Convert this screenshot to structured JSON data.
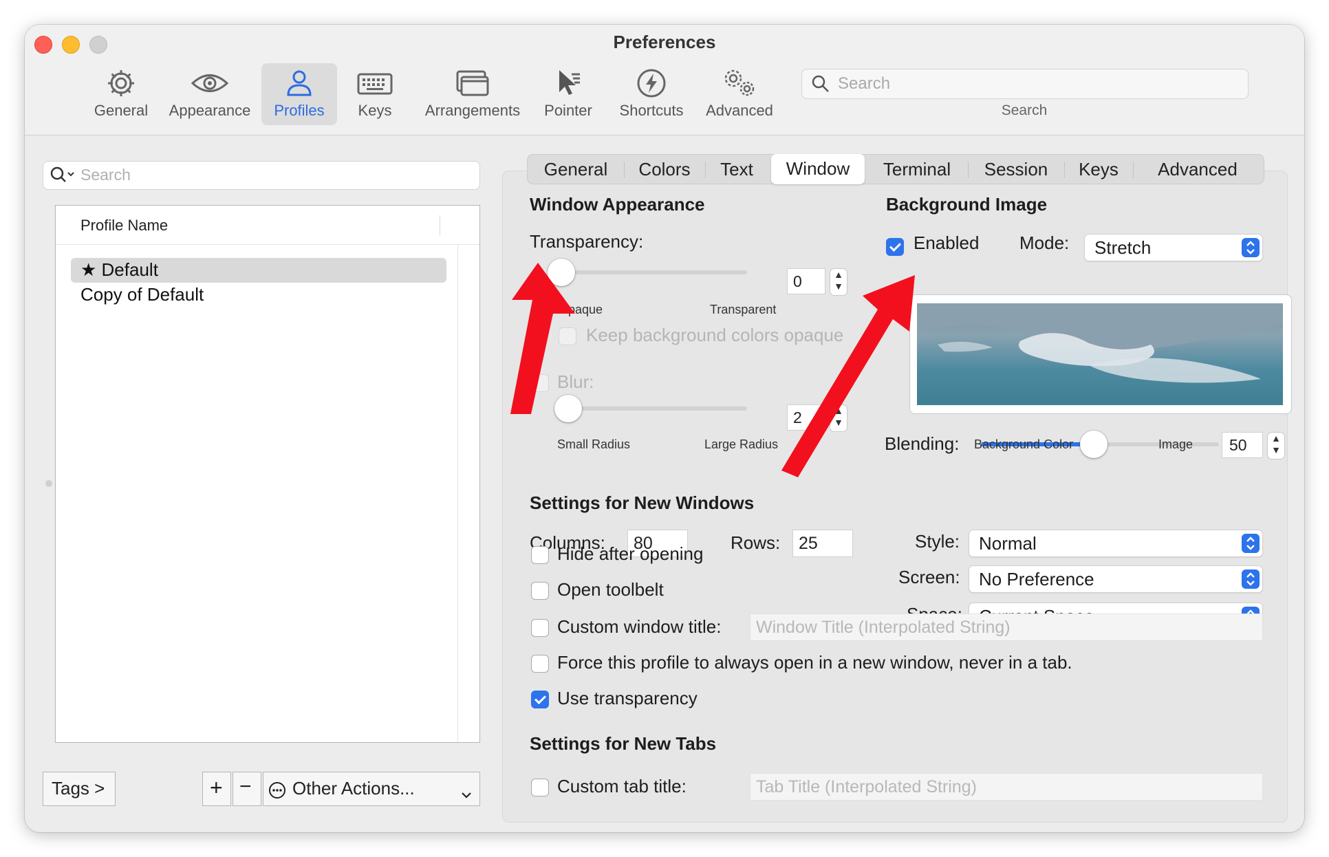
{
  "window": {
    "title": "Preferences"
  },
  "toolbar": {
    "items": [
      {
        "label": "General",
        "icon": "gear-icon"
      },
      {
        "label": "Appearance",
        "icon": "eye-icon"
      },
      {
        "label": "Profiles",
        "icon": "person-icon",
        "selected": true
      },
      {
        "label": "Keys",
        "icon": "keyboard-icon"
      },
      {
        "label": "Arrangements",
        "icon": "windows-icon"
      },
      {
        "label": "Pointer",
        "icon": "pointer-icon"
      },
      {
        "label": "Shortcuts",
        "icon": "lightning-icon"
      },
      {
        "label": "Advanced",
        "icon": "gears-icon"
      }
    ],
    "search_placeholder": "Search",
    "search_label": "Search"
  },
  "profiles": {
    "search_placeholder": "Search",
    "column_header": "Profile Name",
    "rows": [
      {
        "name": "★ Default",
        "selected": true
      },
      {
        "name": "Copy of Default"
      }
    ],
    "tags_button": "Tags >",
    "add_button": "+",
    "remove_button": "−",
    "other_actions": "Other Actions...",
    "other_actions_icon": "ellipsis-circle-icon"
  },
  "tabs": [
    "General",
    "Colors",
    "Text",
    "Window",
    "Terminal",
    "Session",
    "Keys",
    "Advanced"
  ],
  "selected_tab": "Window",
  "window_appearance": {
    "title": "Window Appearance",
    "transparency_label": "Transparency:",
    "transparency_value": "0",
    "opaque_label": "Opaque",
    "transparent_label": "Transparent",
    "keep_bg_opaque_label": "Keep background colors opaque",
    "blur_label": "Blur:",
    "blur_value": "2",
    "small_radius_label": "Small Radius",
    "large_radius_label": "Large Radius"
  },
  "background_image": {
    "title": "Background Image",
    "enabled_label": "Enabled",
    "enabled": true,
    "mode_label": "Mode:",
    "mode_value": "Stretch",
    "blending_label": "Blending:",
    "blending_value": "50",
    "blending_fraction": 0.5,
    "bg_color_label": "Background Color",
    "image_label": "Image"
  },
  "new_windows": {
    "title": "Settings for New Windows",
    "columns_label": "Columns:",
    "columns_value": "80",
    "rows_label": "Rows:",
    "rows_value": "25",
    "style_label": "Style:",
    "style_value": "Normal",
    "screen_label": "Screen:",
    "screen_value": "No Preference",
    "space_label": "Space:",
    "space_value": "Current Space",
    "hide_after_opening": "Hide after opening",
    "open_toolbelt": "Open toolbelt",
    "custom_window_title": "Custom window title:",
    "window_title_placeholder": "Window Title (Interpolated String)",
    "force_new_window": "Force this profile to always open in a new window, never in a tab.",
    "use_transparency": "Use transparency",
    "use_transparency_checked": true
  },
  "new_tabs": {
    "title": "Settings for New Tabs",
    "custom_tab_title": "Custom tab title:",
    "tab_title_placeholder": "Tab Title (Interpolated String)"
  },
  "colors": {
    "accent": "#2c73ec",
    "selected_toolbar_text": "#2c6ce0",
    "annotation_arrow": "#f2101e"
  }
}
